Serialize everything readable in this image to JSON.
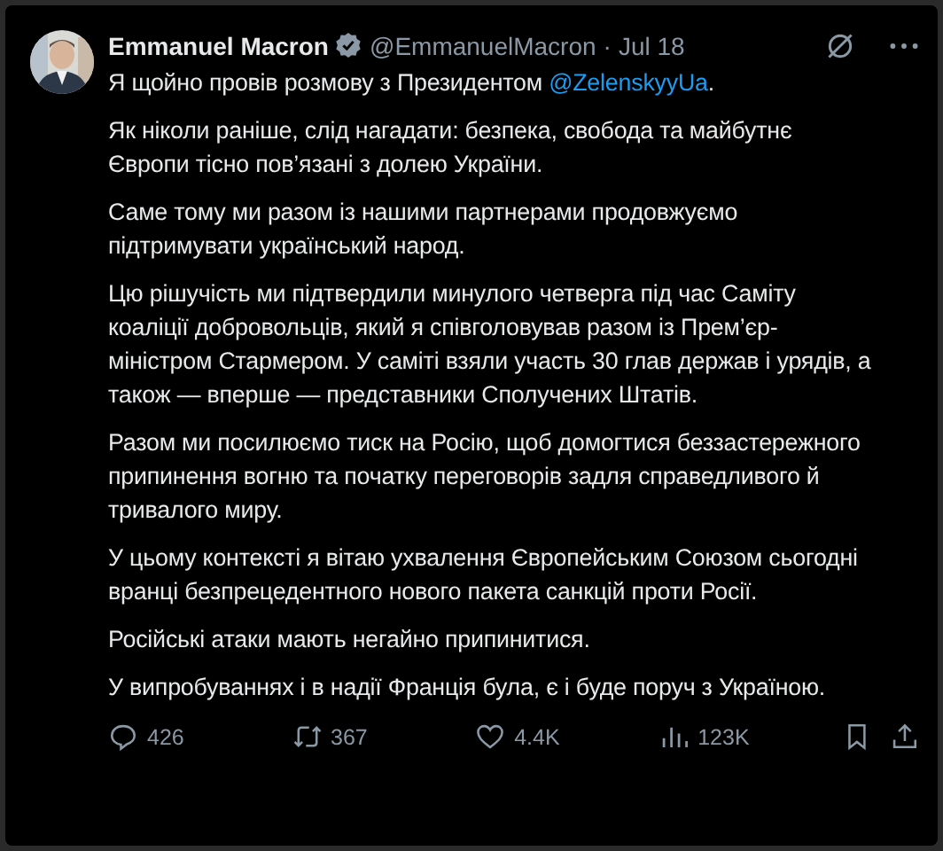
{
  "author": {
    "name": "Emmanuel Macron",
    "verified": true,
    "handle": "@EmmanuelMacron",
    "separator": "·",
    "date": "Jul 18"
  },
  "paragraphs": [
    {
      "text": "Я щойно провів розмову з Президентом ",
      "mention": "@ZelenskyyUa",
      "after": "."
    },
    {
      "text": "Як ніколи раніше, слід нагадати: безпека, свобода та майбутнє Європи тісно пов’язані з долею України."
    },
    {
      "text": "Саме тому ми разом із нашими партнерами продовжуємо підтримувати український народ."
    },
    {
      "text": "Цю рішучість ми підтвердили минулого четверга під час Саміту коаліції добровольців, який я співголовував разом із Прем’єр-міністром Стармером. У саміті взяли участь 30 глав держав і урядів, а також — вперше — представники Сполучених Штатів."
    },
    {
      "text": "Разом ми посилюємо тиск на Росію, щоб домогтися беззастережного припинення вогню та початку переговорів задля справедливого й тривалого миру."
    },
    {
      "text": "У цьому контексті я вітаю ухвалення Європейським Союзом сьогодні вранці безпрецедентного нового пакета санкцій проти Росії."
    },
    {
      "text": "Російські атаки мають негайно припинитися."
    },
    {
      "text": "У випробуваннях і в надії Франція була, є і буде поруч з Україною."
    }
  ],
  "actions": [
    {
      "kind": "reply",
      "count": "426"
    },
    {
      "kind": "repost",
      "count": "367"
    },
    {
      "kind": "like",
      "count": "4.4K"
    },
    {
      "kind": "views",
      "count": "123K"
    }
  ]
}
